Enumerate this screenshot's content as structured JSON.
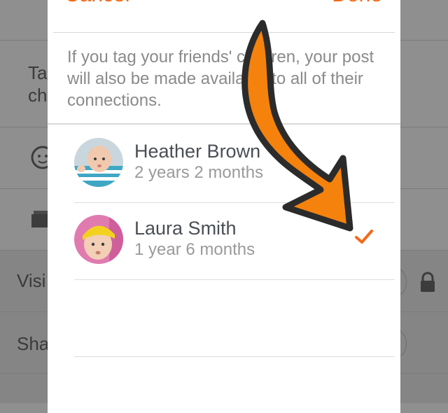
{
  "header": {
    "cancel_label": "Cancel",
    "done_label": "Done"
  },
  "notice": "If you tag your friends' children, your post will also be made available to all of their connections.",
  "children": [
    {
      "name": "Heather Brown",
      "age": "2 years 2 months",
      "selected": false
    },
    {
      "name": "Laura Smith",
      "age": "1 year 6 months",
      "selected": true
    }
  ],
  "background": {
    "row1_text": "Ta\nch",
    "visibility_label": "Visi",
    "share_label": "Sha"
  },
  "colors": {
    "accent": "#f26a1b",
    "arrow_fill": "#f5820d",
    "arrow_outline": "#2b2b2b"
  },
  "icons": {
    "face": "face-icon",
    "folder": "folder-icon",
    "lock": "lock-icon",
    "check": "checkmark-icon"
  }
}
